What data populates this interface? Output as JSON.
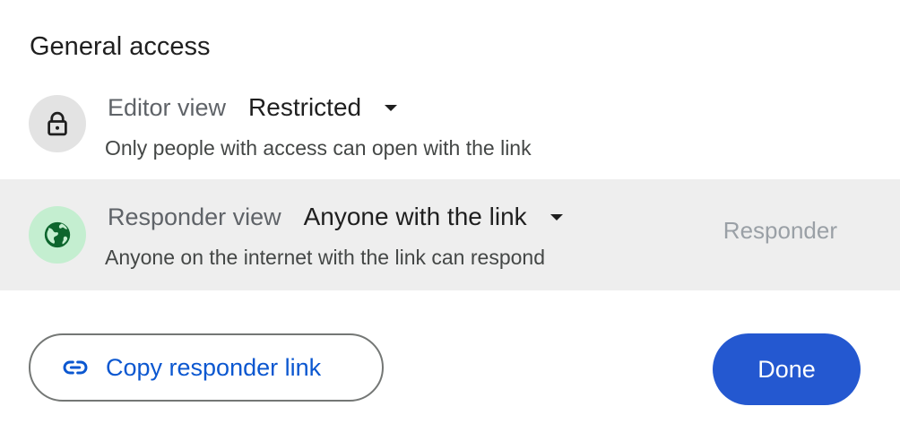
{
  "general_access": {
    "title": "General access"
  },
  "editor": {
    "icon": "lock-icon",
    "label": "Editor view",
    "value": "Restricted",
    "description": "Only people with access can open with the link"
  },
  "responder": {
    "icon": "globe-icon",
    "label": "Responder view",
    "value": "Anyone with the link",
    "description": "Anyone on the internet with the link can respond",
    "role": "Responder"
  },
  "actions": {
    "copy_icon": "link-icon",
    "copy_label": "Copy responder link",
    "done_label": "Done"
  },
  "colors": {
    "accent": "#0b57d0",
    "done_bg": "#2458d0",
    "responder_row_bg": "#eeeeee",
    "globe_avatar_bg": "#c4eed0",
    "lock_avatar_bg": "#e3e3e3"
  }
}
